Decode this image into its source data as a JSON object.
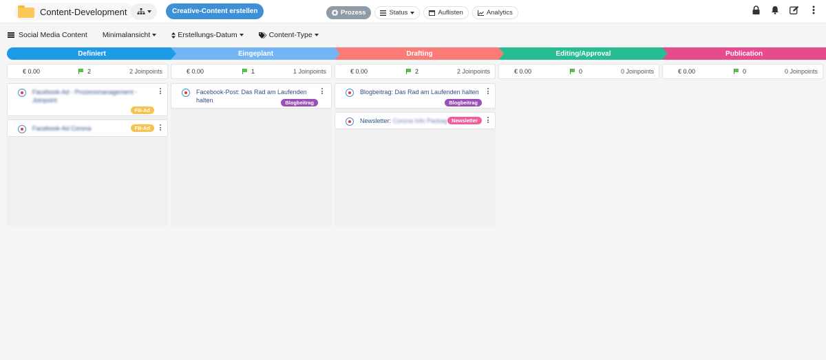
{
  "header": {
    "project_title": "Content-Development",
    "create_button": "Creative-Content erstellen",
    "views": [
      {
        "label": "Prozess",
        "active": true
      },
      {
        "label": "Status",
        "active": false
      },
      {
        "label": "Auflisten",
        "active": false
      },
      {
        "label": "Analytics",
        "active": false
      }
    ],
    "icons": [
      "lock-icon",
      "bell-icon",
      "edit-icon",
      "more-vertical-icon"
    ]
  },
  "filters": {
    "board_name": "Social Media Content",
    "view_mode": "Minimalansicht",
    "sort": "Erstellungs-Datum",
    "content_type": "Content-Type"
  },
  "colors": {
    "definiert": "#1e9be6",
    "eingeplant": "#74b5f5",
    "drafting": "#fb7b76",
    "editing": "#26bd92",
    "publication": "#e84a8e",
    "tag_fb_ad": "#f7c24f",
    "tag_blogbeitrag": "#9b4fb8",
    "tag_newsletter": "#ef5f99"
  },
  "columns": [
    {
      "phase": "Definiert",
      "amount": "€ 0.00",
      "count": "2",
      "joinpoints": "2 Joinpoints",
      "cards": [
        {
          "title_prefix": "",
          "title_blurred": "Facebook-Ad - Prozessmanagement - Joinpoint",
          "tag": "FB-Ad"
        },
        {
          "title_prefix": "",
          "title_blurred": "Facebook-Ad Corona",
          "tag": "FB-Ad"
        }
      ]
    },
    {
      "phase": "Eingeplant",
      "amount": "€ 0.00",
      "count": "1",
      "joinpoints": "1 Joinpoints",
      "cards": [
        {
          "title_prefix": "Facebook-Post: Das Rad am Laufenden halten",
          "title_blurred": "",
          "tag": "Blogbeitrag"
        }
      ]
    },
    {
      "phase": "Drafting",
      "amount": "€ 0.00",
      "count": "2",
      "joinpoints": "2 Joinpoints",
      "cards": [
        {
          "title_prefix": "Blogbeitrag: Das Rad am Laufenden halten",
          "title_blurred": "",
          "tag": "Blogbeitrag"
        },
        {
          "title_prefix": "Newsletter: ",
          "title_blurred": "Corona Info Package",
          "tag": "Newsletter"
        }
      ]
    },
    {
      "phase": "Editing/Approval",
      "amount": "€ 0.00",
      "count": "0",
      "joinpoints": "0 Joinpoints",
      "cards": []
    },
    {
      "phase": "Publication",
      "amount": "€ 0.00",
      "count": "0",
      "joinpoints": "0 Joinpoints",
      "cards": []
    }
  ]
}
